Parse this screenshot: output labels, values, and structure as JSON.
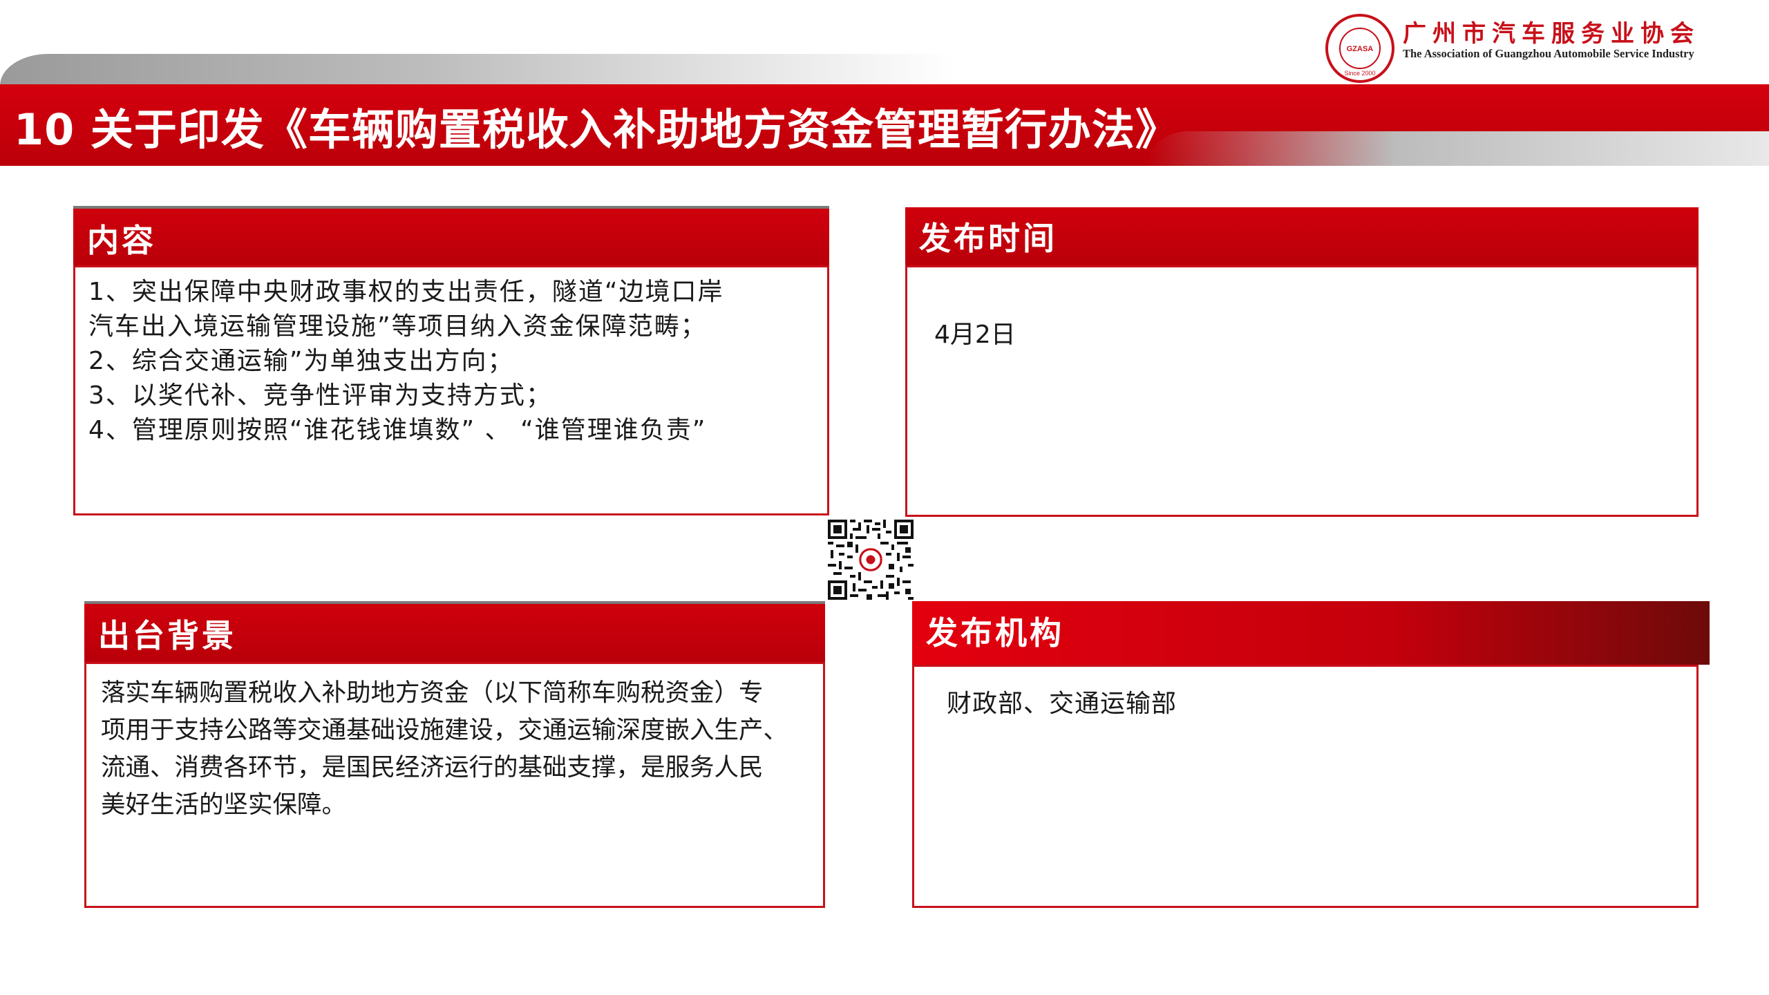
{
  "header": {
    "title": "10 关于印发《车辆购置税收入补助地方资金管理暂行办法》"
  },
  "logo": {
    "name_cn": "广州市汽车服务业协会",
    "name_en": "The Association of Guangzhou Automobile Service Industry",
    "seal_abbrev": "GZASA",
    "seal_since": "Since 2000"
  },
  "sections": {
    "content": {
      "label": "内容",
      "text": "1、突出保障中央财政事权的支出责任，隧道“边境口岸\n汽车出入境运输管理设施”等项目纳入资金保障范畴；\n2、综合交通运输”为单独支出方向；\n3、以奖代补、竞争性评审为支持方式；\n4、管理原则按照“谁花钱谁填数” 、 “谁管理谁负责”"
    },
    "publish_time": {
      "label": "发布时间",
      "text": "4月2日"
    },
    "background": {
      "label": "出台背景",
      "text": "落实车辆购置税收入补助地方资金（以下简称车购税资金）专\n项用于支持公路等交通基础设施建设，交通运输深度嵌入生产、\n流通、消费各环节，是国民经济运行的基础支撑，是服务人民\n美好生活的坚实保障。"
    },
    "publisher": {
      "label": "发布机构",
      "text": "财政部、交通运输部"
    }
  },
  "colors": {
    "brand_red": "#c8101a",
    "header_grey": "#9a9a9a"
  },
  "icons": {
    "qr": "qr-code-icon"
  }
}
